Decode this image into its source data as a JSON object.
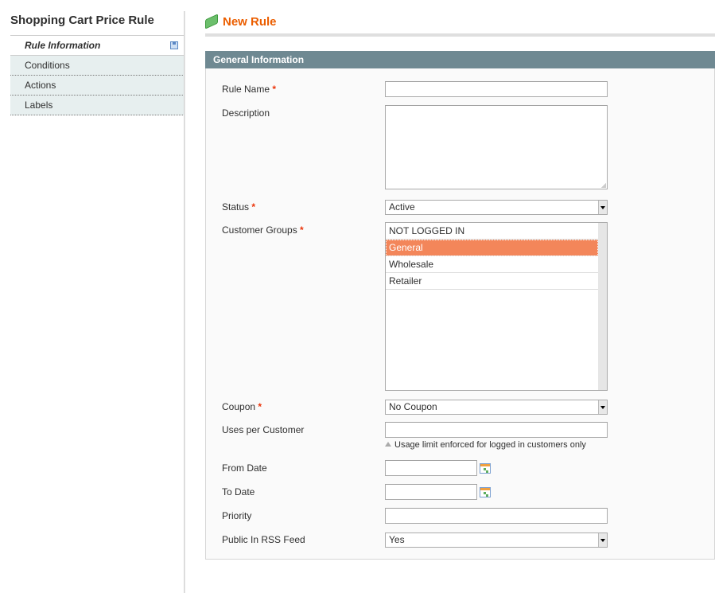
{
  "sidebar": {
    "title": "Shopping Cart Price Rule",
    "tabs": [
      {
        "label": "Rule Information",
        "active": true
      },
      {
        "label": "Conditions"
      },
      {
        "label": "Actions"
      },
      {
        "label": "Labels"
      }
    ]
  },
  "header": {
    "title": "New Rule",
    "icon": "money-icon"
  },
  "fieldset": {
    "title": "General Information"
  },
  "form": {
    "rule_name": {
      "label": "Rule Name",
      "required": "*",
      "value": ""
    },
    "description": {
      "label": "Description",
      "value": ""
    },
    "status": {
      "label": "Status",
      "required": "*",
      "value": "Active"
    },
    "customer_groups": {
      "label": "Customer Groups",
      "required": "*",
      "options": [
        "NOT LOGGED IN",
        "General",
        "Wholesale",
        "Retailer"
      ],
      "selected": "General"
    },
    "coupon": {
      "label": "Coupon",
      "required": "*",
      "value": "No Coupon"
    },
    "uses_per_customer": {
      "label": "Uses per Customer",
      "value": "",
      "note": "Usage limit enforced for logged in customers only"
    },
    "from_date": {
      "label": "From Date",
      "value": ""
    },
    "to_date": {
      "label": "To Date",
      "value": ""
    },
    "priority": {
      "label": "Priority",
      "value": ""
    },
    "rss": {
      "label": "Public In RSS Feed",
      "value": "Yes"
    }
  },
  "colors": {
    "accent": "#eb5e00",
    "fieldset_header": "#6f8992",
    "selected_option": "#f3865a",
    "required": "#eb340a"
  }
}
